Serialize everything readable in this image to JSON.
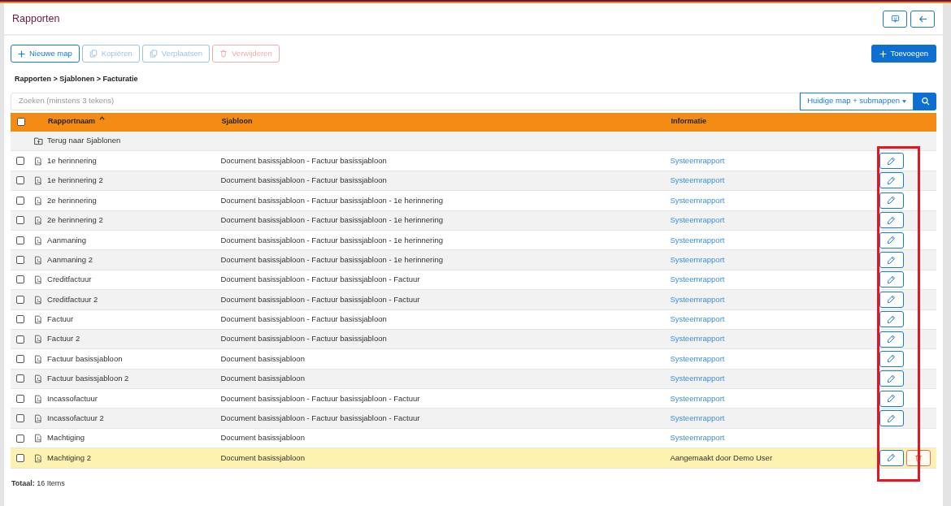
{
  "page": {
    "title": "Rapporten"
  },
  "header_buttons": [
    {
      "kind": "feedback"
    },
    {
      "kind": "back"
    }
  ],
  "toolbar": [
    {
      "label": "Nieuwe map",
      "kind": "add",
      "disabled": false
    },
    {
      "label": "Kopiëren",
      "kind": "copy",
      "disabled": true
    },
    {
      "label": "Verplaatsen",
      "kind": "copy",
      "disabled": true
    },
    {
      "label": "Verwijderen",
      "kind": "delete",
      "disabled": true
    }
  ],
  "add_button": {
    "label": "Toevoegen"
  },
  "breadcrumb": "Rapporten > Sjablonen > Facturatie",
  "search": {
    "placeholder": "Zoeken (minstens 3 tekens)",
    "scope": "Huidige map + submappen"
  },
  "table": {
    "select_all": {
      "checked": false
    },
    "columns": [
      {
        "label": "Rapportnaam",
        "sorted": true
      },
      {
        "label": "Sjabloon",
        "sorted": false
      },
      {
        "label": "Informatie",
        "sorted": false
      }
    ],
    "back_row": {
      "label": "Terug naar Sjablonen"
    },
    "rows": [
      {
        "checked": false,
        "name": "1e herinnering",
        "template": "Document basissjabloon - Factuur basissjabloon",
        "info": "Systeemrapport",
        "kind": "link",
        "editable": true,
        "deletable": false,
        "highlighted": false
      },
      {
        "checked": false,
        "name": "1e herinnering 2",
        "template": "Document basissjabloon - Factuur basissjabloon",
        "info": "Systeemrapport",
        "kind": "link",
        "editable": true,
        "deletable": false,
        "highlighted": false
      },
      {
        "checked": false,
        "name": "2e herinnering",
        "template": "Document basissjabloon - Factuur basissjabloon - 1e herinnering",
        "info": "Systeemrapport",
        "kind": "link",
        "editable": true,
        "deletable": false,
        "highlighted": false
      },
      {
        "checked": false,
        "name": "2e herinnering 2",
        "template": "Document basissjabloon - Factuur basissjabloon - 1e herinnering",
        "info": "Systeemrapport",
        "kind": "link",
        "editable": true,
        "deletable": false,
        "highlighted": false
      },
      {
        "checked": false,
        "name": "Aanmaning",
        "template": "Document basissjabloon - Factuur basissjabloon - 1e herinnering",
        "info": "Systeemrapport",
        "kind": "link",
        "editable": true,
        "deletable": false,
        "highlighted": false
      },
      {
        "checked": false,
        "name": "Aanmaning 2",
        "template": "Document basissjabloon - Factuur basissjabloon - 1e herinnering",
        "info": "Systeemrapport",
        "kind": "link",
        "editable": true,
        "deletable": false,
        "highlighted": false
      },
      {
        "checked": false,
        "name": "Creditfactuur",
        "template": "Document basissjabloon - Factuur basissjabloon - Factuur",
        "info": "Systeemrapport",
        "kind": "link",
        "editable": true,
        "deletable": false,
        "highlighted": false
      },
      {
        "checked": false,
        "name": "Creditfactuur 2",
        "template": "Document basissjabloon - Factuur basissjabloon - Factuur",
        "info": "Systeemrapport",
        "kind": "link",
        "editable": true,
        "deletable": false,
        "highlighted": false
      },
      {
        "checked": false,
        "name": "Factuur",
        "template": "Document basissjabloon - Factuur basissjabloon",
        "info": "Systeemrapport",
        "kind": "link",
        "editable": true,
        "deletable": false,
        "highlighted": false
      },
      {
        "checked": false,
        "name": "Factuur 2",
        "template": "Document basissjabloon - Factuur basissjabloon",
        "info": "Systeemrapport",
        "kind": "link",
        "editable": true,
        "deletable": false,
        "highlighted": false
      },
      {
        "checked": false,
        "name": "Factuur basissjabloon",
        "template": "Document basissjabloon",
        "info": "Systeemrapport",
        "kind": "link",
        "editable": true,
        "deletable": false,
        "highlighted": false
      },
      {
        "checked": false,
        "name": "Factuur basissjabloon 2",
        "template": "Document basissjabloon",
        "info": "Systeemrapport",
        "kind": "link",
        "editable": true,
        "deletable": false,
        "highlighted": false
      },
      {
        "checked": false,
        "name": "Incassofactuur",
        "template": "Document basissjabloon - Factuur basissjabloon - Factuur",
        "info": "Systeemrapport",
        "kind": "link",
        "editable": true,
        "deletable": false,
        "highlighted": false
      },
      {
        "checked": false,
        "name": "Incassofactuur 2",
        "template": "Document basissjabloon - Factuur basissjabloon - Factuur",
        "info": "Systeemrapport",
        "kind": "link",
        "editable": true,
        "deletable": false,
        "highlighted": false
      },
      {
        "checked": false,
        "name": "Machtiging",
        "template": "Document basissjabloon",
        "info": "Systeemrapport",
        "kind": "link",
        "editable": false,
        "deletable": false,
        "highlighted": false
      },
      {
        "checked": false,
        "name": "Machtiging 2",
        "template": "Document basissjabloon",
        "info": "Aangemaakt door Demo User",
        "kind": "text",
        "editable": true,
        "deletable": true,
        "highlighted": true
      }
    ]
  },
  "total": {
    "label": "Totaal:",
    "value": "16 Items"
  },
  "annotation": {
    "kind": "highlight-frame"
  }
}
